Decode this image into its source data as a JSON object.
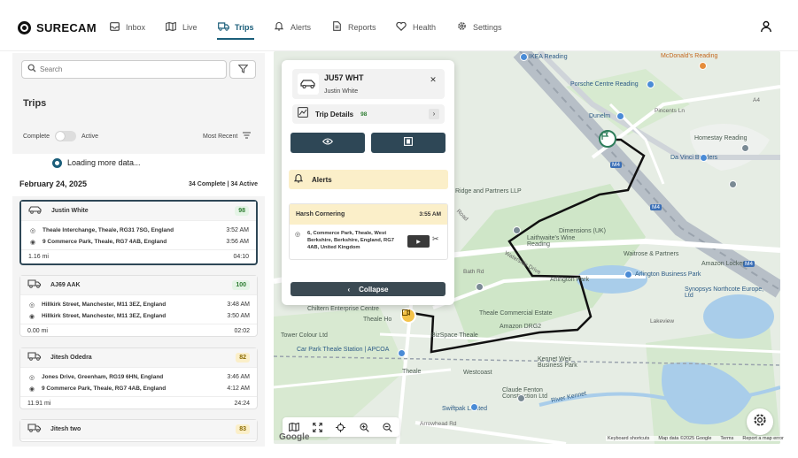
{
  "brand": {
    "name": "SURECAM"
  },
  "nav": {
    "items": [
      {
        "label": "Inbox",
        "icon": "inbox-icon"
      },
      {
        "label": "Live",
        "icon": "map-icon"
      },
      {
        "label": "Trips",
        "icon": "truck-icon",
        "active": true
      },
      {
        "label": "Alerts",
        "icon": "bell-icon"
      },
      {
        "label": "Reports",
        "icon": "report-icon"
      },
      {
        "label": "Health",
        "icon": "heart-icon"
      },
      {
        "label": "Settings",
        "icon": "gear-icon"
      }
    ]
  },
  "sidebar": {
    "search_placeholder": "Search",
    "title": "Trips",
    "toggle_left": "Complete",
    "toggle_right": "Active",
    "sort_label": "Most Recent",
    "loading": "Loading more data...",
    "date": "February 24, 2025",
    "counts": "34 Complete | 34 Active",
    "trips": [
      {
        "name": "Justin White",
        "score": "98",
        "score_color": "green",
        "start_addr": "Theale Interchange, Theale, RG31 7SG, England",
        "start_time": "3:52 AM",
        "end_addr": "9 Commerce Park, Theale, RG7 4AB, England",
        "end_time": "3:56 AM",
        "distance": "1.16 mi",
        "duration": "04:10"
      },
      {
        "name": "AJ69 AAK",
        "score": "100",
        "score_color": "green",
        "start_addr": "Hillkirk Street, Manchester, M11 3EZ, England",
        "start_time": "3:48 AM",
        "end_addr": "Hillkirk Street, Manchester, M11 3EZ, England",
        "end_time": "3:50 AM",
        "distance": "0.00 mi",
        "duration": "02:02"
      },
      {
        "name": "Jitesh Odedra",
        "score": "82",
        "score_color": "amber",
        "start_addr": "Jones Drive, Greenham, RG19 6HN, England",
        "start_time": "3:46 AM",
        "end_addr": "9 Commerce Park, Theale, RG7 4AB, England",
        "end_time": "4:12 AM",
        "distance": "11.91 mi",
        "duration": "24:24"
      },
      {
        "name": "Jitesh two",
        "score": "83",
        "score_color": "amber"
      }
    ]
  },
  "popup": {
    "plate": "JU57 WHT",
    "driver": "Justin White",
    "details_label": "Trip Details",
    "details_score": "98",
    "alerts_label": "Alerts",
    "alert": {
      "type": "Harsh Cornering",
      "time": "3:55 AM",
      "address": "6, Commerce Park, Theale, West Berkshire, Berkshire, England, RG7 4AB, United Kingdom"
    },
    "collapse_label": "Collapse"
  },
  "map": {
    "labels": {
      "ikea": "IKEA Reading",
      "mcdonalds": "McDonald's Reading",
      "porsche": "Porsche Centre Reading",
      "dunelm": "Dunelm",
      "pincents": "Pincents Ln",
      "homestay": "Homestay Reading",
      "davinci": "Da Vinci Builders",
      "ridge": "Ridge and Partners LLP",
      "road": "Road",
      "dimensions": "Dimensions (UK)",
      "waitrose": "Waitrose & Partners",
      "laithwaites": "Laithwaite's Wine Reading",
      "waterside": "Waterside Drive",
      "arlington": "Arlington Park",
      "arlington_bp": "Arlington Business Park",
      "synopsys": "Synopsys Northcote Europe, Ltd",
      "chiltern": "Chiltern Enterprise Centre",
      "theale_commercial": "Theale Commercial Estate",
      "amazon": "Amazon DRG2",
      "bizspace": "BizSpace Theale",
      "tower": "Tower Colour Ltd",
      "carpark": "Car Park Theale Station | APCOA",
      "theale_hotel": "Theale Ho",
      "theale": "Theale",
      "westcoast": "Westcoast",
      "kennet_weir": "Kennet Weir Business Park",
      "claude": "Claude Fenton Construction Ltd",
      "swiftpak": "Swiftpak Limited",
      "river_kennet": "River Kennet",
      "lakeview": "Lakeview",
      "bath_rd": "Bath Rd",
      "arrowhead": "Arrowhead Rd",
      "a4": "A4",
      "m4": "M4",
      "a4_shield": "A4",
      "m4_shield": "M4",
      "locker": "Amazon Locker",
      "m4_road": "M4"
    },
    "attrib": {
      "shortcuts": "Keyboard shortcuts",
      "mapdata": "Map data ©2025 Google",
      "terms": "Terms",
      "report": "Report a map error"
    },
    "google": "Google"
  },
  "colors": {
    "accent": "#2e4756",
    "active_nav": "#1b5e7a",
    "alert_bg": "#fbefc9",
    "route": "#111111"
  }
}
